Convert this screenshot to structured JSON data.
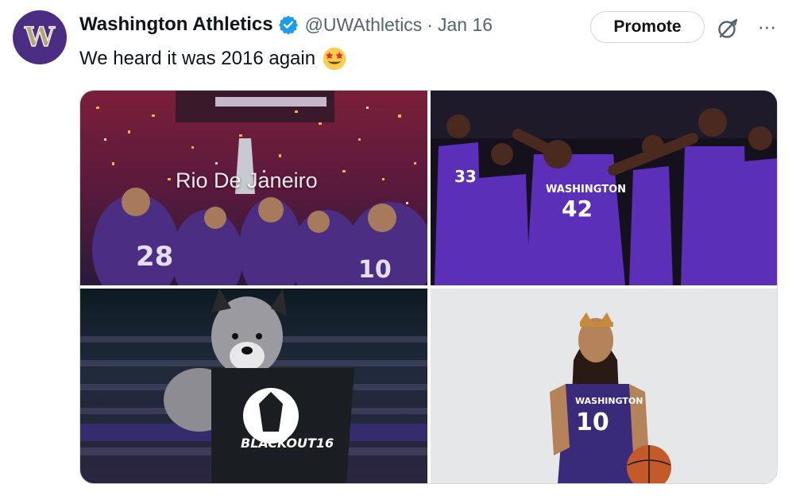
{
  "author": {
    "name": "Washington Athletics",
    "handle": "@UWAthletics",
    "separator": "·",
    "date": "Jan 16",
    "avatar_letter": "W",
    "brand_color": "#4b2e83"
  },
  "actions": {
    "promote_label": "Promote",
    "grok_icon": "grok-icon",
    "more_label": "···"
  },
  "tweet": {
    "text": "We heard it was 2016 again",
    "emoji": "star-struck"
  },
  "media": {
    "images": [
      {
        "id": "celebration",
        "description_icon": "photo",
        "overlay_text": "Rio De Janeiro"
      },
      {
        "id": "basketball-team",
        "jersey_numbers": [
          "33",
          "42"
        ],
        "jersey_text": "WASHINGTON"
      },
      {
        "id": "mascot",
        "shirt_text": "BLACKOUT16"
      },
      {
        "id": "player-portrait",
        "jersey_number": "10",
        "jersey_text": "WASHINGTON"
      }
    ]
  },
  "colors": {
    "verified_blue": "#1d9bf0",
    "text_secondary": "#536471",
    "border": "#cfd9de"
  }
}
